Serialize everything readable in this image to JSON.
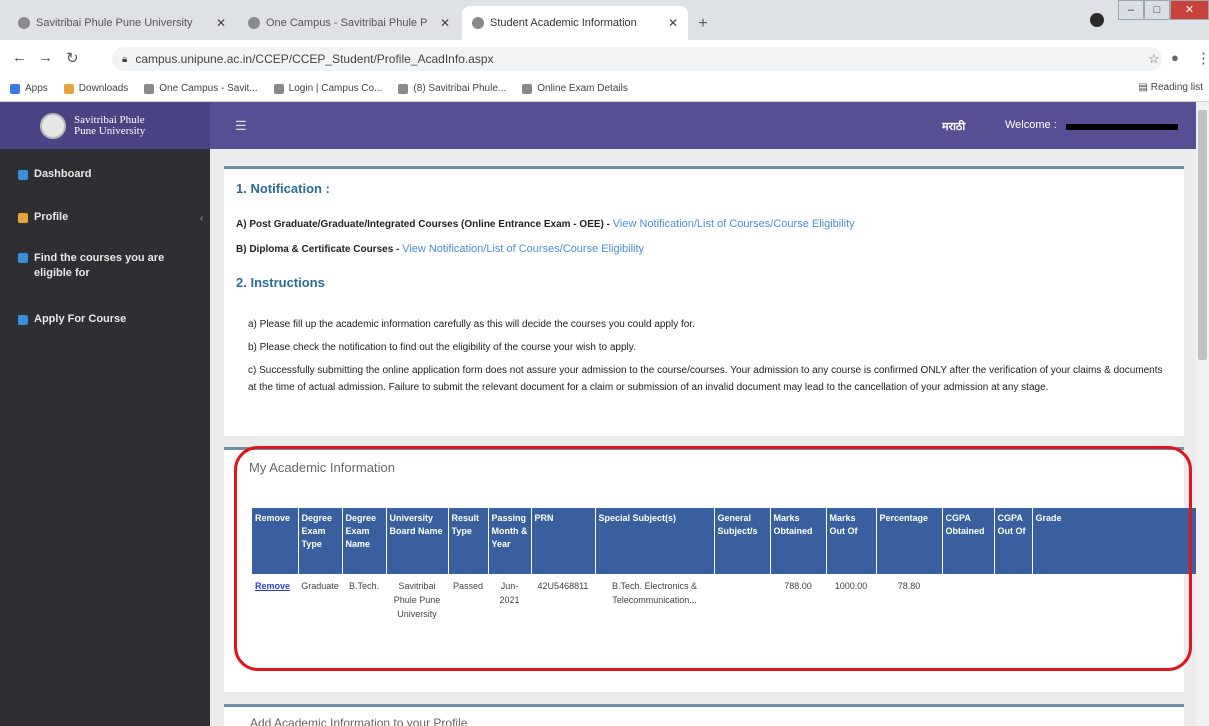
{
  "browser": {
    "tabs": [
      {
        "label": "Savitribai Phule Pune University"
      },
      {
        "label": "One Campus - Savitribai Phule P"
      },
      {
        "label": "Student Academic Information"
      }
    ],
    "url": "campus.unipune.ac.in/CCEP/CCEP_Student/Profile_AcadInfo.aspx",
    "bookmarks": [
      {
        "label": "Apps",
        "icon": "apps-grid-icon"
      },
      {
        "label": "Downloads",
        "icon": "download-icon"
      },
      {
        "label": "One Campus - Savit..."
      },
      {
        "label": "Login | Campus Co..."
      },
      {
        "label": "(8) Savitribai Phule..."
      },
      {
        "label": "Online Exam Details"
      }
    ],
    "reading_list": "Reading list"
  },
  "app": {
    "logo_line1": "Savitribai Phule",
    "logo_line2": "Pune University",
    "marathi_label": "मराठी",
    "welcome_label": "Welcome :"
  },
  "sidebar": {
    "items": [
      {
        "label": "Dashboard",
        "color": "#3b8fd8"
      },
      {
        "label": "Profile",
        "color": "#e8a33a"
      },
      {
        "label": "Find the courses you are eligible for",
        "color": "#3b8fd8"
      },
      {
        "label": "Apply For Course",
        "color": "#3b8fd8"
      }
    ]
  },
  "notification": {
    "heading": "1. Notification :",
    "line_a_prefix": "A) Post Graduate/Graduate/Integrated Courses (Online Entrance Exam - OEE) -",
    "line_a_link": "View Notification/List of Courses/Course Eligibility",
    "line_b_prefix": "B) Diploma & Certificate Courses -",
    "line_b_link": "View Notification/List of Courses/Course Eligibility"
  },
  "instructions": {
    "heading": "2. Instructions",
    "a": "a) Please fill up the academic information carefully as this will decide the courses you could apply for.",
    "b": "b) Please check the notification to find out the eligibility of the course your wish to apply.",
    "c": "c) Successfully submitting the online application form does not assure your admission to the course/courses. Your admission to any course is confirmed ONLY after the verification of your claims & documents at the time of actual admission. Failure to submit the relevant document for a claim or submission of an invalid document may lead to the cancellation of your admission at any stage."
  },
  "academic": {
    "title": "My Academic Information",
    "headers": [
      "Remove",
      "Degree Exam Type",
      "Degree Exam Name",
      "University Board Name",
      "Result Type",
      "Passing Month & Year",
      "PRN",
      "Special Subject(s)",
      "General Subject/s",
      "Marks Obtained",
      "Marks Out Of",
      "Percentage",
      "CGPA Obtained",
      "CGPA Out Of",
      "Grade"
    ],
    "row": {
      "remove": "Remove",
      "exam_type": "Graduate",
      "exam_name": "B.Tech.",
      "board": "Savitribai Phule Pune University",
      "result": "Passed",
      "passing": "Jun-2021",
      "prn": "42U5468811",
      "special": "B.Tech. Electronics & Telecommunication...",
      "general": "",
      "marks_obtained": "788.00",
      "marks_out_of": "1000.00",
      "percentage": "78.80",
      "cgpa_obtained": "",
      "cgpa_out_of": "",
      "grade": ""
    }
  },
  "add_section": {
    "title": "Add Academic Information to your Profile"
  }
}
